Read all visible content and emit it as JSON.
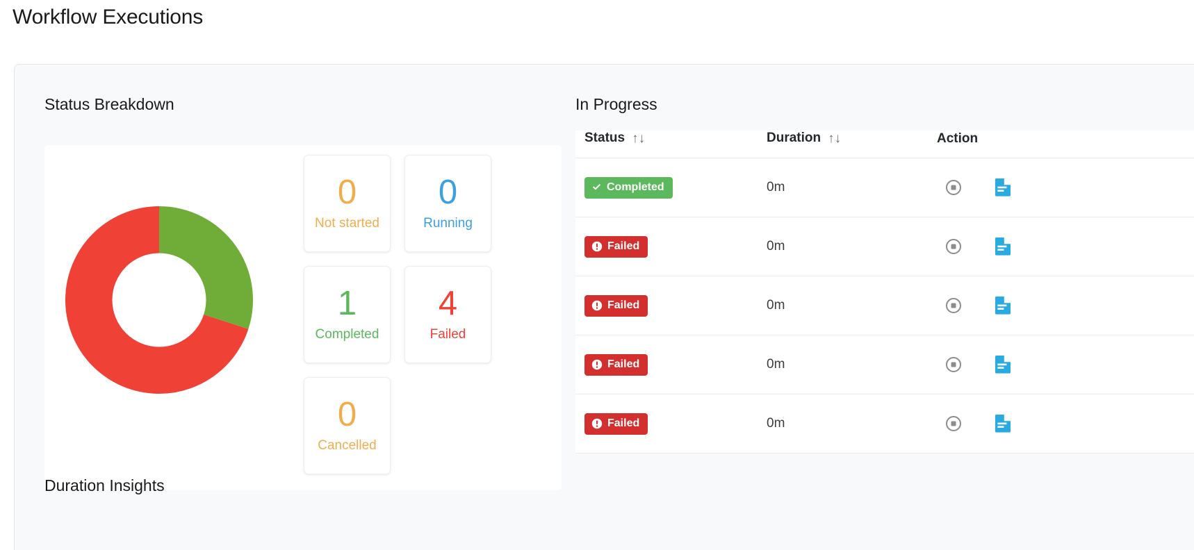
{
  "page": {
    "title": "Workflow Executions"
  },
  "status_breakdown": {
    "heading": "Status Breakdown",
    "stats": [
      {
        "value": "0",
        "label": "Not started",
        "color": "#f0ad4e",
        "key": "not-started"
      },
      {
        "value": "0",
        "label": "Running",
        "color": "#3aa0e0",
        "key": "running"
      },
      {
        "value": "1",
        "label": "Completed",
        "color": "#5cb85c",
        "key": "completed"
      },
      {
        "value": "4",
        "label": "Failed",
        "color": "#ef4136",
        "key": "failed"
      },
      {
        "value": "0",
        "label": "Cancelled",
        "color": "#f0ad4e",
        "key": "cancelled"
      }
    ]
  },
  "chart_data": {
    "type": "pie",
    "title": "Status Breakdown",
    "variant": "donut",
    "labels": [
      "Completed",
      "Failed"
    ],
    "values": [
      1,
      4
    ],
    "colors": [
      "#70ad38",
      "#ef4136"
    ],
    "percentages": [
      20,
      80
    ],
    "total": 5,
    "start_angle": 0,
    "inner_radius_ratio": 0.5,
    "legend": "none",
    "all_categories": [
      "Not started",
      "Running",
      "Completed",
      "Failed",
      "Cancelled"
    ],
    "all_values": [
      0,
      0,
      1,
      4,
      0
    ]
  },
  "in_progress": {
    "heading": "In Progress",
    "columns": [
      {
        "label": "Status",
        "sortable": true,
        "sort_icon": "↑↓"
      },
      {
        "label": "Duration",
        "sortable": true,
        "sort_icon": "↑↓"
      },
      {
        "label": "Action",
        "sortable": false,
        "sort_icon": ""
      }
    ],
    "rows": [
      {
        "status": "Completed",
        "status_type": "completed",
        "status_icon": "check-icon",
        "duration": "0m"
      },
      {
        "status": "Failed",
        "status_type": "failed",
        "status_icon": "exclamation-circle-icon",
        "duration": "0m"
      },
      {
        "status": "Failed",
        "status_type": "failed",
        "status_icon": "exclamation-circle-icon",
        "duration": "0m"
      },
      {
        "status": "Failed",
        "status_type": "failed",
        "status_icon": "exclamation-circle-icon",
        "duration": "0m"
      },
      {
        "status": "Failed",
        "status_type": "failed",
        "status_icon": "exclamation-circle-icon",
        "duration": "0m"
      }
    ],
    "actions": [
      {
        "name": "stop-icon",
        "color": "#8c8c8c"
      },
      {
        "name": "log-document-icon",
        "color": "#29abe2"
      }
    ]
  },
  "duration_insights": {
    "heading": "Duration Insights"
  }
}
